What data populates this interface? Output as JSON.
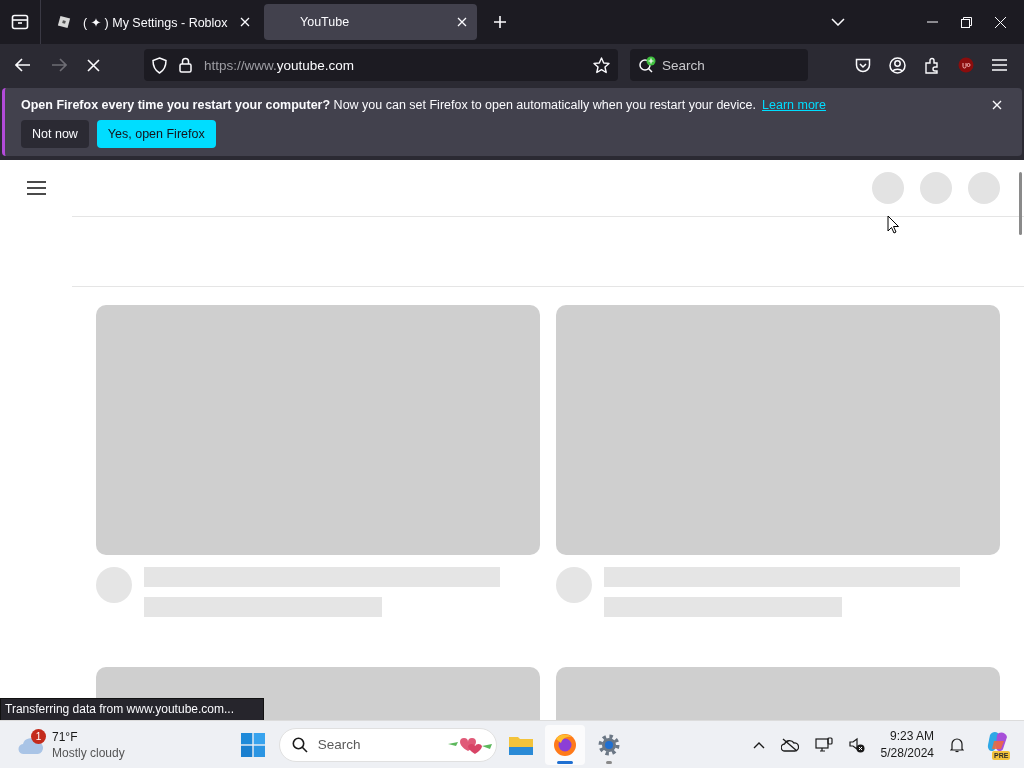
{
  "browser": {
    "tabs": [
      {
        "title": "( ✦ ) My Settings - Roblox",
        "selected": false,
        "favicon": true
      },
      {
        "title": "YouTube",
        "selected": true,
        "favicon": false
      }
    ],
    "url_prefix": "https://www.",
    "url_host": "youtube.com",
    "search": {
      "placeholder": "Search"
    }
  },
  "notification": {
    "question": "Open Firefox every time you restart your computer?",
    "message": "Now you can set Firefox to open automatically when you restart your device.",
    "link": "Learn more",
    "buttons": [
      {
        "label": "Not now",
        "kind": "secondary"
      },
      {
        "label": "Yes, open Firefox",
        "kind": "primary"
      }
    ]
  },
  "status_text": "Transferring data from www.youtube.com...",
  "taskbar": {
    "weather": {
      "badge": "1",
      "temperature": "71°F",
      "condition": "Mostly cloudy"
    },
    "search": {
      "placeholder": "Search"
    },
    "apps": [
      {
        "kind": "files",
        "active": false,
        "running": false
      },
      {
        "kind": "firefox",
        "active": true,
        "running": true
      },
      {
        "kind": "settings",
        "active": false,
        "running": true
      }
    ],
    "clock": {
      "time": "9:23 AM",
      "date": "5/28/2024"
    },
    "copilot_badge": "PRE"
  }
}
